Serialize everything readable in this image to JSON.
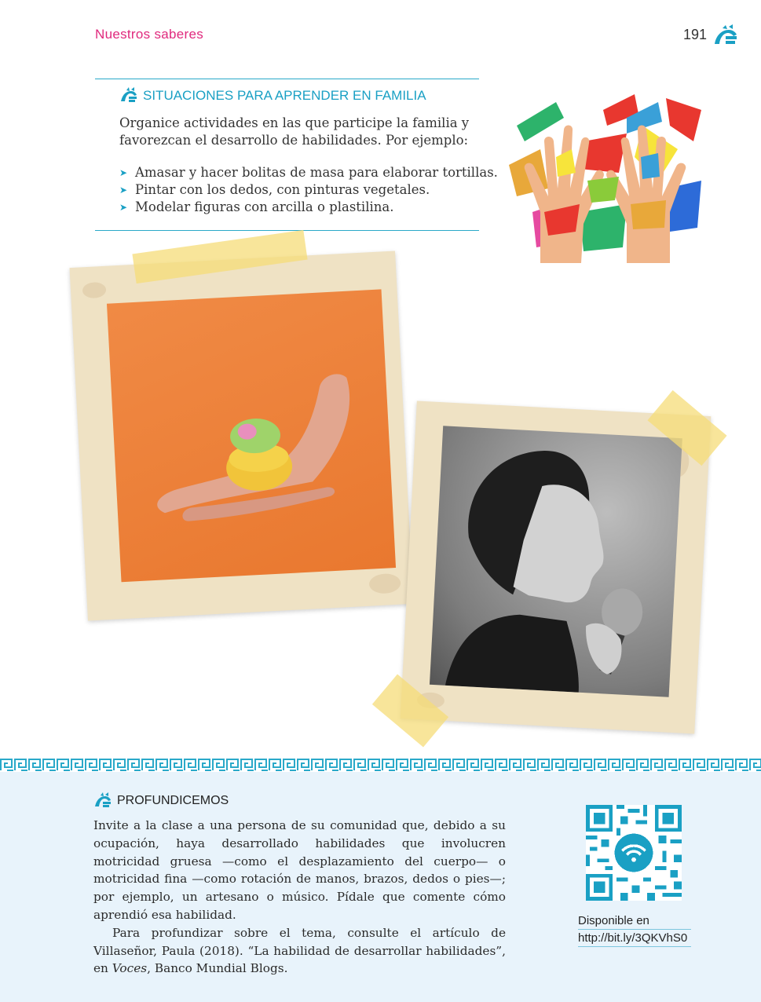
{
  "header": {
    "section_title": "Nuestros saberes",
    "page_number": "191"
  },
  "family_box": {
    "heading": "SITUACIONES PARA APRENDER  EN FAMILIA",
    "intro_line1": "Organice actividades en las que participe la familia y",
    "intro_line2": "favorezcan el desarrollo de habilidades. Por ejemplo:",
    "items": [
      "Amasar y hacer bolitas de masa para elaborar tortillas.",
      "Pintar con los dedos, con pinturas vegetales.",
      "Modelar figuras con arcilla o plastilina."
    ]
  },
  "profundicemos": {
    "heading": "PROFUNDICEMOS",
    "para1": "Invite a la clase a una persona de su comunidad que, debido a su ocupación, haya desarrollado habilidades que involucren motricidad gruesa —como el desplazamiento del cuerpo— o motricidad fina —como rotación de manos, brazos, dedos o pies—; por ejemplo, un artesano o músico. Pídale que comente cómo aprendió esa habilidad.",
    "para2_start": "Para profundizar sobre el tema, consulte el artículo de Villaseñor, Paula (2018). “La habilidad de desarrollar habilidades”, en ",
    "para2_italic": "Voces",
    "para2_end": ", Banco Mundial Blogs.",
    "available_label": "Disponible en",
    "url": "http://bit.ly/3QKVhS0"
  },
  "colors": {
    "accent_pink": "#e0297d",
    "accent_cyan": "#1aa0c4",
    "panel_bg": "#e8f3fb"
  },
  "icons": [
    "quetzalcoatl-glyph-icon",
    "bullet-arrow-icon",
    "qr-code-icon"
  ]
}
